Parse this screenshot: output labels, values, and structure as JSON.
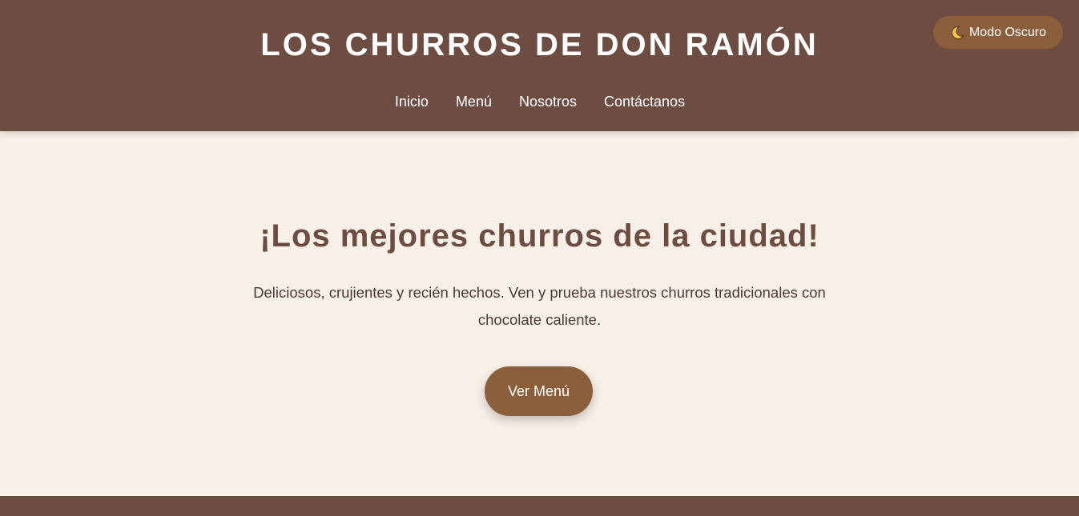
{
  "header": {
    "title": "LOS CHURROS DE DON RAMÓN",
    "nav": [
      {
        "label": "Inicio"
      },
      {
        "label": "Menú"
      },
      {
        "label": "Nosotros"
      },
      {
        "label": "Contáctanos"
      }
    ],
    "theme_toggle": {
      "icon": "moon-icon",
      "label": "Modo Oscuro"
    }
  },
  "hero": {
    "title": "¡Los mejores churros de la ciudad!",
    "text": "Deliciosos, crujientes y recién hechos. Ven y prueba nuestros churros tradicionales con chocolate caliente.",
    "cta_label": "Ver Menú"
  },
  "colors": {
    "header_bg": "#6d4c41",
    "page_bg": "#f7f0e7",
    "accent": "#8b5e3c",
    "heading": "#6d4c41"
  }
}
